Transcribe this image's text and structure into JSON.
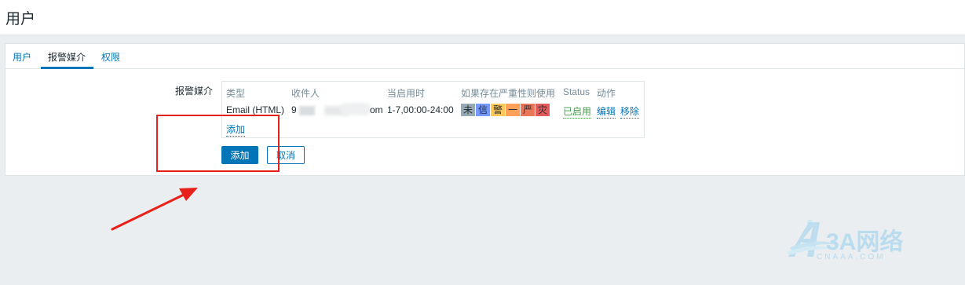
{
  "page": {
    "title": "用户"
  },
  "tabs": [
    {
      "label": "用户",
      "active": false
    },
    {
      "label": "报警媒介",
      "active": true
    },
    {
      "label": "权限",
      "active": false
    }
  ],
  "form": {
    "media_label": "报警媒介",
    "table": {
      "headers": {
        "type": "类型",
        "recipient": "收件人",
        "when_active": "当启用时",
        "severity": "如果存在严重性则使用",
        "status": "Status",
        "action": "动作"
      },
      "row": {
        "type": "Email (HTML)",
        "recipient_start": "9",
        "recipient_end": "om",
        "when_active": "1-7,00:00-24:00",
        "severities": [
          {
            "label": "未",
            "color": "#97aab3"
          },
          {
            "label": "信",
            "color": "#7499ff"
          },
          {
            "label": "警",
            "color": "#ffc859"
          },
          {
            "label": "一",
            "color": "#ffa059"
          },
          {
            "label": "严",
            "color": "#e97659"
          },
          {
            "label": "灾",
            "color": "#e45959"
          }
        ],
        "status": "已启用",
        "edit": "编辑",
        "remove": "移除"
      },
      "add_link": "添加"
    },
    "add_button": "添加",
    "cancel_button": "取消"
  },
  "watermark": {
    "brand_text": "3A网络",
    "domain_text": "CNAAA.COM",
    "registered_mark": "®"
  },
  "colors": {
    "accent": "#0275b8",
    "status_enabled": "#429e47",
    "annotation": "#e8201a"
  }
}
